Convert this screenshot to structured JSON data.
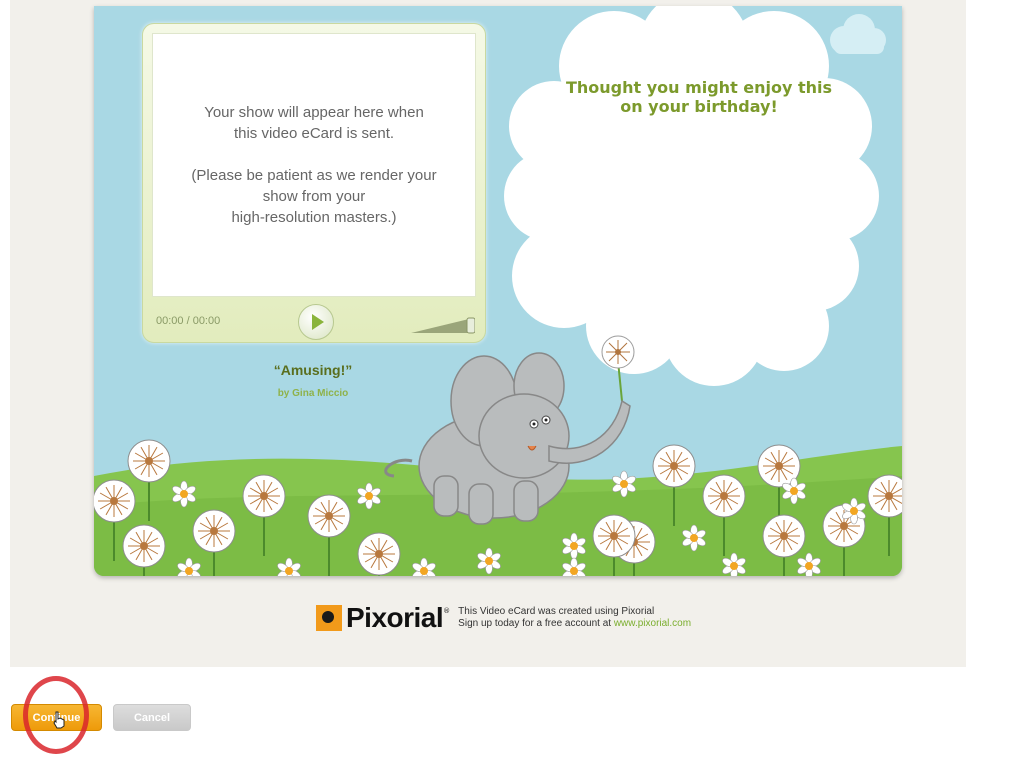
{
  "player": {
    "placeholder_line1": "Your show will appear here when\nthis video eCard is sent.",
    "placeholder_line2": "(Please be patient as we render your\nshow from your\nhigh-resolution masters.)",
    "time": "00:00 / 00:00",
    "play_icon": "play-icon",
    "volume_icon": "volume-icon"
  },
  "show": {
    "title": "“Amusing!”",
    "author": "by Gina Miccio"
  },
  "card": {
    "message": "Thought you might enjoy this on your birthday!"
  },
  "brand": {
    "name": "Pixorial",
    "registered": "®",
    "promo_line1": "This Video eCard was created using Pixorial",
    "promo_line2_prefix": "Sign up today for a free account at ",
    "promo_link": "www.pixorial.com"
  },
  "actions": {
    "continue_label": "Continue",
    "cancel_label": "Cancel"
  },
  "colors": {
    "sky": "#a9d8e4",
    "grass": "#7fc04a",
    "accent_orange": "#f29a1a",
    "text_green": "#7c9a2c",
    "highlight_red": "#d9262c"
  }
}
